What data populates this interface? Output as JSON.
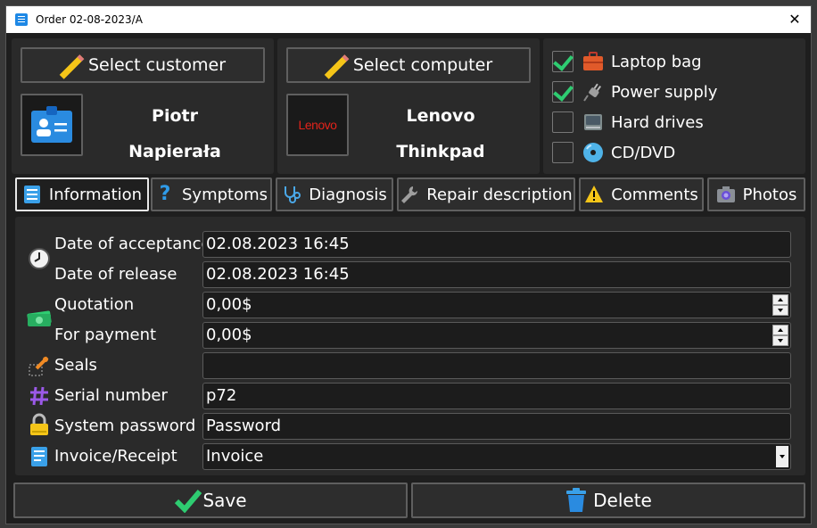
{
  "window": {
    "title": "Order 02-08-2023/A"
  },
  "customer": {
    "select_label": "Select customer",
    "first_name": "Piotr",
    "last_name": "Napierała"
  },
  "computer": {
    "select_label": "Select computer",
    "brand": "Lenovo",
    "model": "Thinkpad",
    "logo_text": "Lenovo"
  },
  "accessories": [
    {
      "label": "Laptop bag",
      "checked": true
    },
    {
      "label": "Power supply",
      "checked": true
    },
    {
      "label": "Hard drives",
      "checked": false
    },
    {
      "label": "CD/DVD",
      "checked": false
    }
  ],
  "tabs": [
    {
      "label": "Information",
      "active": true
    },
    {
      "label": "Symptoms",
      "active": false
    },
    {
      "label": "Diagnosis",
      "active": false
    },
    {
      "label": "Repair description",
      "active": false
    },
    {
      "label": "Comments",
      "active": false
    },
    {
      "label": "Photos",
      "active": false
    }
  ],
  "form": {
    "date_of_acceptance": {
      "label": "Date of acceptance",
      "value": "02.08.2023 16:45"
    },
    "date_of_release": {
      "label": "Date of release",
      "value": "02.08.2023 16:45"
    },
    "quotation": {
      "label": "Quotation",
      "value": "0,00$"
    },
    "for_payment": {
      "label": "For payment",
      "value": "0,00$"
    },
    "seals": {
      "label": "Seals",
      "value": ""
    },
    "serial_number": {
      "label": "Serial number",
      "value": "p72"
    },
    "system_password": {
      "label": "System password",
      "value": "Password"
    },
    "invoice_receipt": {
      "label": "Invoice/Receipt",
      "value": "Invoice"
    }
  },
  "actions": {
    "save_label": "Save",
    "delete_label": "Delete"
  },
  "colors": {
    "accent_check": "#2ecc71",
    "background": "#1e1e1e",
    "panel": "#2a2a2a",
    "lenovo_red": "#e2231a"
  }
}
